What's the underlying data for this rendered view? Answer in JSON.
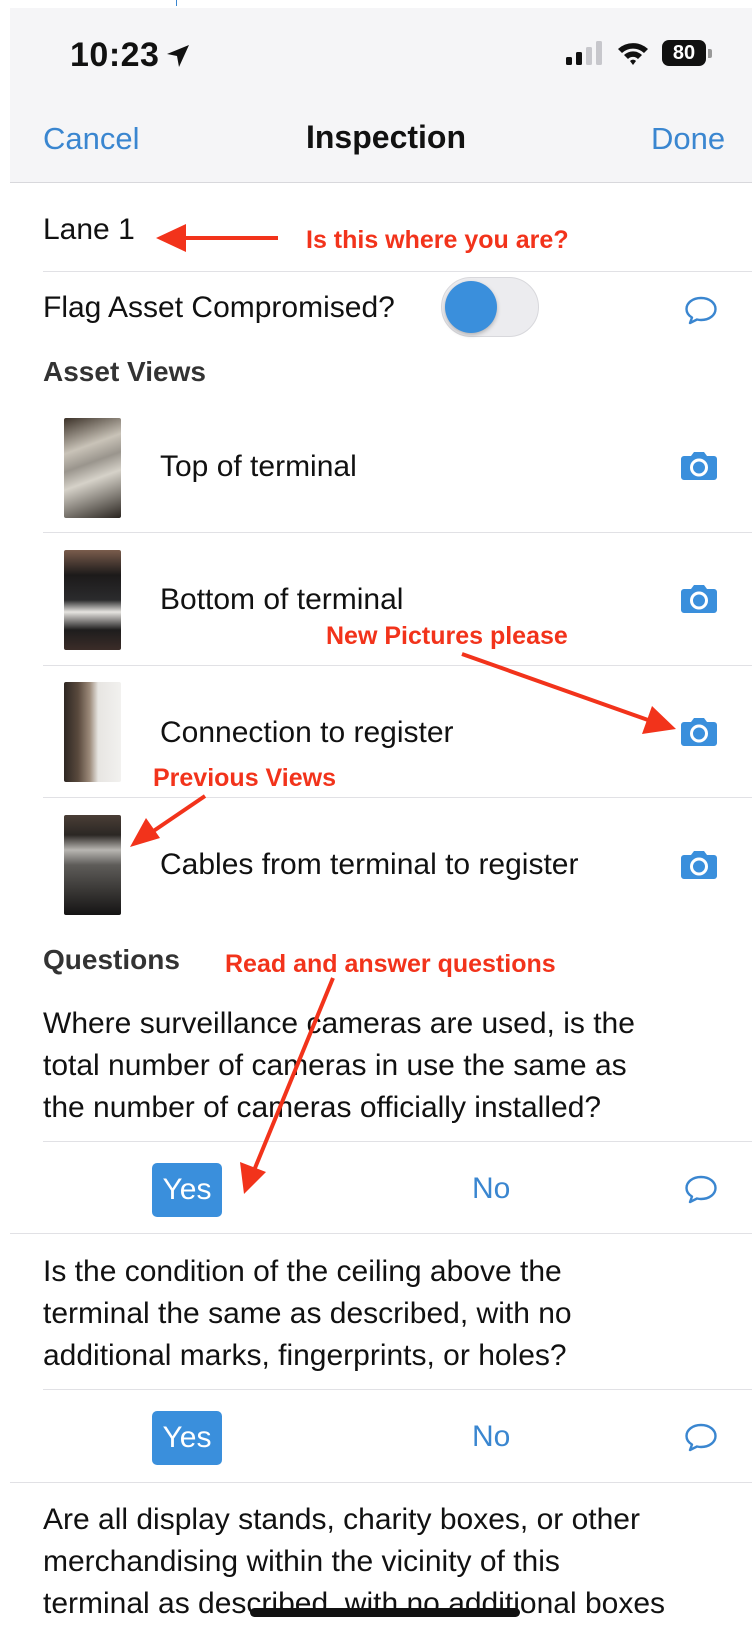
{
  "status_bar": {
    "time": "10:23",
    "battery": "80"
  },
  "nav": {
    "cancel": "Cancel",
    "title": "Inspection",
    "done": "Done"
  },
  "location": {
    "label": "Lane 1"
  },
  "flag": {
    "label": "Flag Asset Compromised?",
    "enabled": true
  },
  "asset_views": {
    "heading": "Asset Views",
    "items": [
      {
        "label": "Top of terminal"
      },
      {
        "label": "Bottom of terminal"
      },
      {
        "label": "Connection to register"
      },
      {
        "label": "Cables from terminal to register"
      }
    ]
  },
  "questions": {
    "heading": "Questions",
    "items": [
      {
        "lines": [
          "Where surveillance cameras are used, is the",
          "total number of cameras in use the same as",
          "the number of cameras officially installed?"
        ],
        "yes": "Yes",
        "no": "No",
        "selected": "Yes"
      },
      {
        "lines": [
          "Is the condition of the ceiling above the",
          "terminal the same as described, with no",
          "additional marks, fingerprints, or holes?"
        ],
        "yes": "Yes",
        "no": "No",
        "selected": "Yes"
      },
      {
        "lines": [
          "Are all display stands, charity boxes, or other",
          "merchandising within the vicinity of this",
          "terminal as described, with no additional boxes"
        ]
      }
    ]
  },
  "annotations": {
    "where": "Is this where you are?",
    "new_pictures": "New Pictures please",
    "previous_views": "Previous Views",
    "read_answer": "Read and answer questions"
  },
  "colors": {
    "accent": "#3a86d0",
    "toggle": "#3a8fdc",
    "annotation": "#f2331b"
  }
}
